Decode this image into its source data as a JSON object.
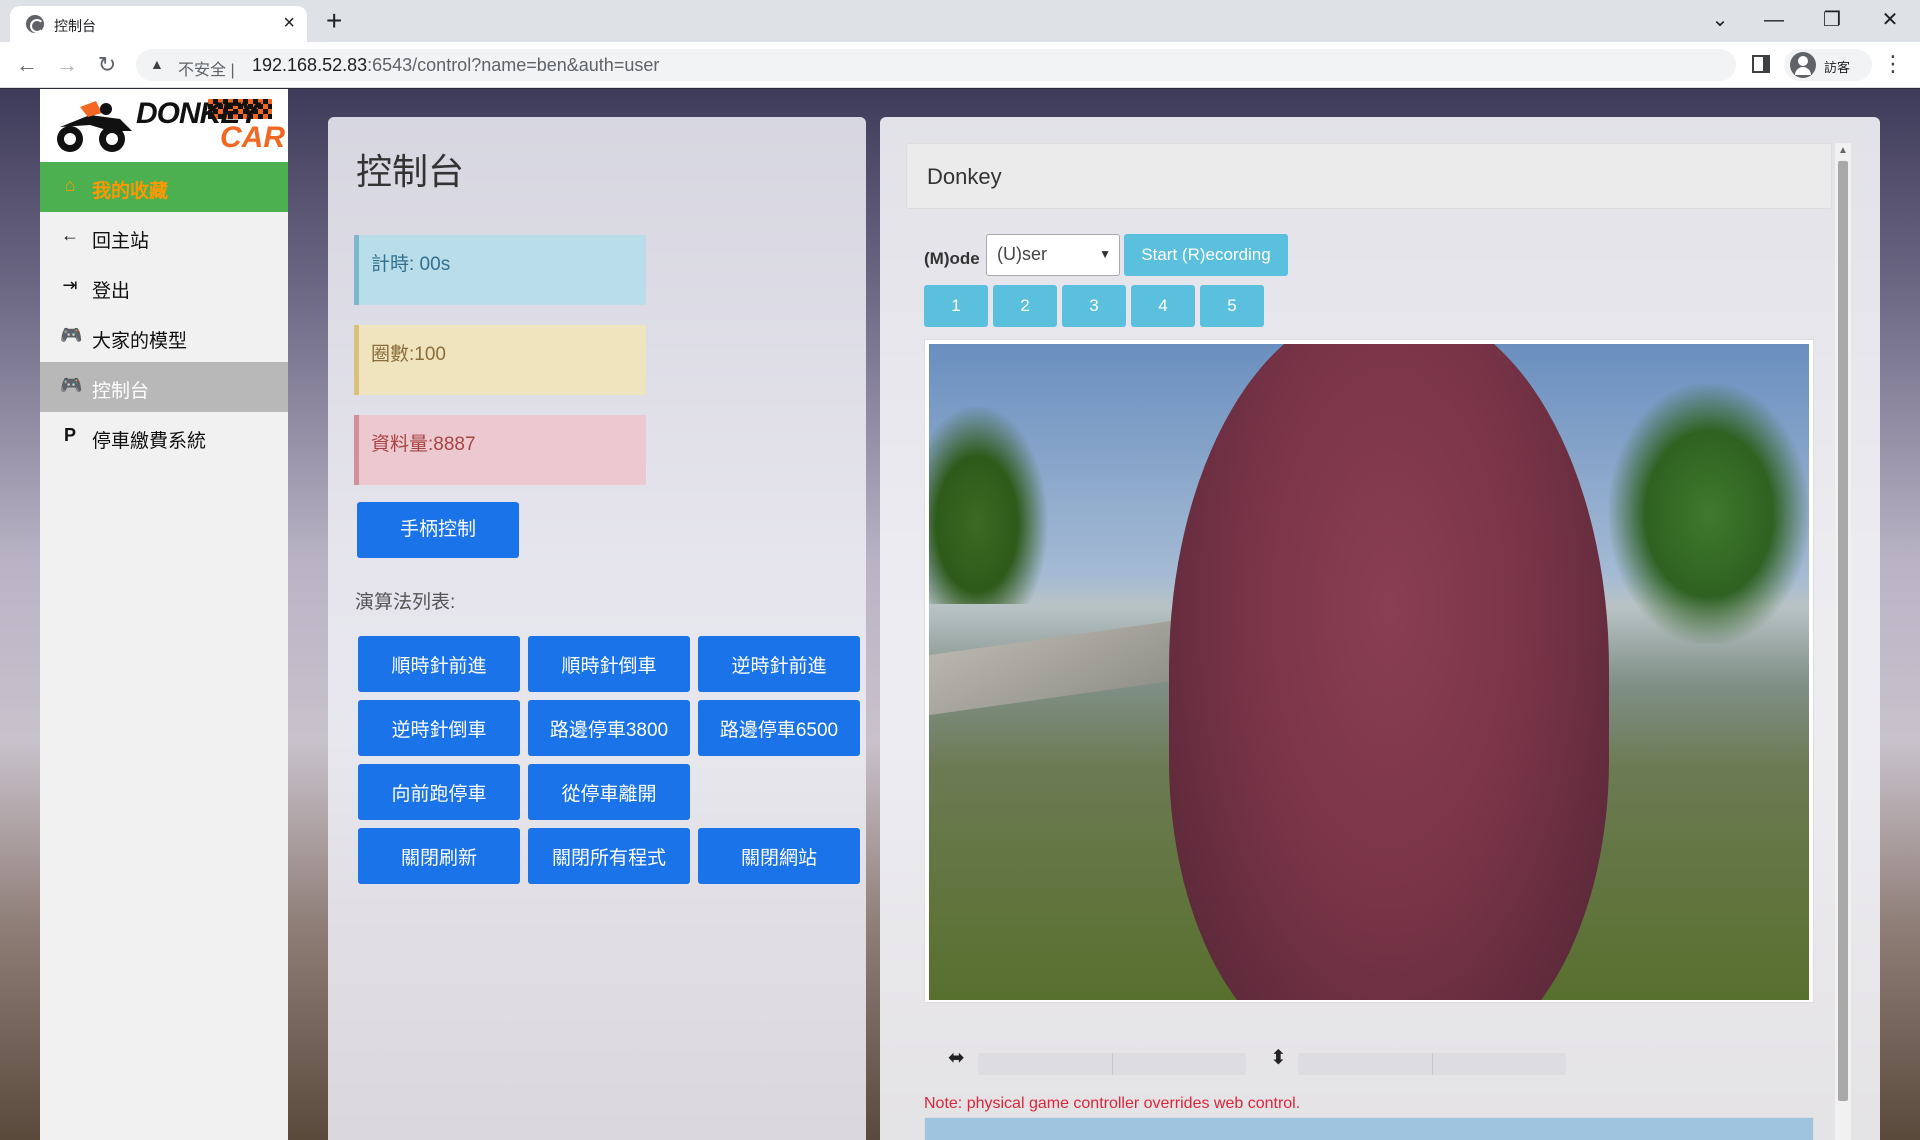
{
  "browser": {
    "tab_title": "控制台",
    "tab_close": "×",
    "new_tab": "+",
    "url_warning": "不安全",
    "url_host": "192.168.52.83",
    "url_rest": ":6543/control?name=ben&auth=user",
    "profile_label": "訪客",
    "icons": [
      "globe-icon",
      "close-icon",
      "back-icon",
      "forward-icon",
      "reload-icon",
      "warning-icon",
      "side-panel-icon",
      "avatar-icon",
      "menu-icon",
      "minimize-icon",
      "restore-icon"
    ]
  },
  "sidebar": {
    "logo_text_1": "DONKEY",
    "logo_text_2": "CAR",
    "items": [
      {
        "label": "我的收藏",
        "icon": "⌂",
        "icon_name": "home-icon"
      },
      {
        "label": "回主站",
        "icon": "←",
        "icon_name": "arrow-left-icon"
      },
      {
        "label": "登出",
        "icon": "⇥",
        "icon_name": "logout-icon"
      },
      {
        "label": "大家的模型",
        "icon": "🎮",
        "icon_name": "gamepad-icon"
      },
      {
        "label": "控制台",
        "icon": "🎮",
        "icon_name": "gamepad-icon"
      },
      {
        "label": "停車繳費系統",
        "icon": "P",
        "icon_name": "parking-icon"
      }
    ],
    "colors": {
      "favorite_bg": "#4caf50",
      "favorite_text": "#ff9800",
      "active_bg": "#b8b8b8"
    }
  },
  "control": {
    "title": "控制台",
    "timer": "計時: 00s",
    "laps": "圈數:100",
    "data_count": "資料量:8887",
    "gamepad_button": "手柄控制",
    "algo_label": "演算法列表:",
    "algorithms": [
      "順時針前進",
      "順時針倒車",
      "逆時針前進",
      "逆時針倒車",
      "路邊停車3800",
      "路邊停車6500",
      "向前跑停車",
      "從停車離開",
      "關閉刷新",
      "關閉所有程式",
      "關閉網站"
    ]
  },
  "donkey": {
    "title": "Donkey",
    "mode_label": "(M)ode",
    "mode_value": "(U)ser",
    "record_button": "Start (R)ecording",
    "number_buttons": [
      "1",
      "2",
      "3",
      "4",
      "5"
    ],
    "steering_icon": "⬌",
    "throttle_icon": "⬍",
    "note": "Note: physical game controller overrides web control.",
    "colors": {
      "primary": "#1a73e8",
      "info": "#5bc0de",
      "note": "#d9263b"
    }
  }
}
